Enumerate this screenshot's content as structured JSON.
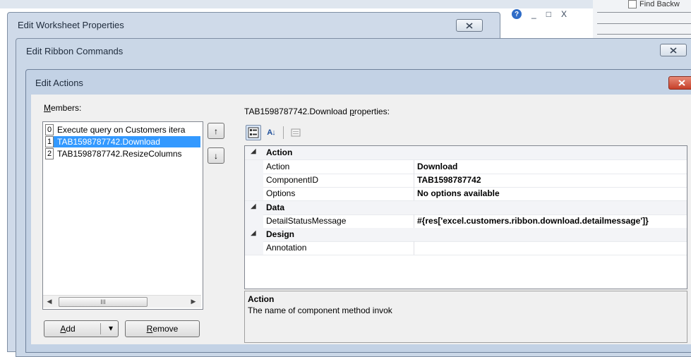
{
  "background_window": {
    "find_label": "Find Backw"
  },
  "window_controls": {
    "help": "?",
    "minimize": "_",
    "maximize": "□",
    "close": "X"
  },
  "dialogs": {
    "worksheet_properties": {
      "title": "Edit Worksheet Properties",
      "close_icon": "close-icon"
    },
    "ribbon_commands": {
      "title": "Edit Ribbon Commands",
      "close_icon": "close-icon"
    },
    "actions": {
      "title": "Edit Actions",
      "close_icon": "close-icon"
    }
  },
  "members": {
    "label_mnemonic": "M",
    "label_rest": "embers:",
    "items": [
      {
        "index": "0",
        "label": "Execute query on Customers itera"
      },
      {
        "index": "1",
        "label": "TAB1598787742.Download",
        "selected": true
      },
      {
        "index": "2",
        "label": "TAB1598787742.ResizeColumns"
      }
    ],
    "scroll_thumb": "III",
    "move_up_icon": "↑",
    "move_down_icon": "↓"
  },
  "buttons": {
    "add_mnemonic": "A",
    "add_rest": "dd",
    "add_dropdown": "▾",
    "remove_mnemonic": "R",
    "remove_rest": "emove"
  },
  "properties": {
    "title_prefix": "TAB1598787742.Download ",
    "title_mnemonic": "p",
    "title_suffix": "roperties:",
    "toolbar": {
      "categorized_icon": "categorized-icon",
      "alphabetical_icon": "alphabetical-icon",
      "alphabetical_glyph": "A↓",
      "property_pages_icon": "property-pages-icon"
    },
    "rows": {
      "action_category": "Action",
      "action_name": "Action",
      "action_value": "Download",
      "componentid_name": "ComponentID",
      "componentid_value": "TAB1598787742",
      "options_name": "Options",
      "options_value": "No options available",
      "data_category": "Data",
      "detail_name": "DetailStatusMessage",
      "detail_value": "#{res['excel.customers.ribbon.download.detailmessage']}",
      "design_category": "Design",
      "annotation_name": "Annotation",
      "annotation_value": ""
    },
    "description": {
      "title": "Action",
      "text": "The name of component method invok"
    }
  }
}
